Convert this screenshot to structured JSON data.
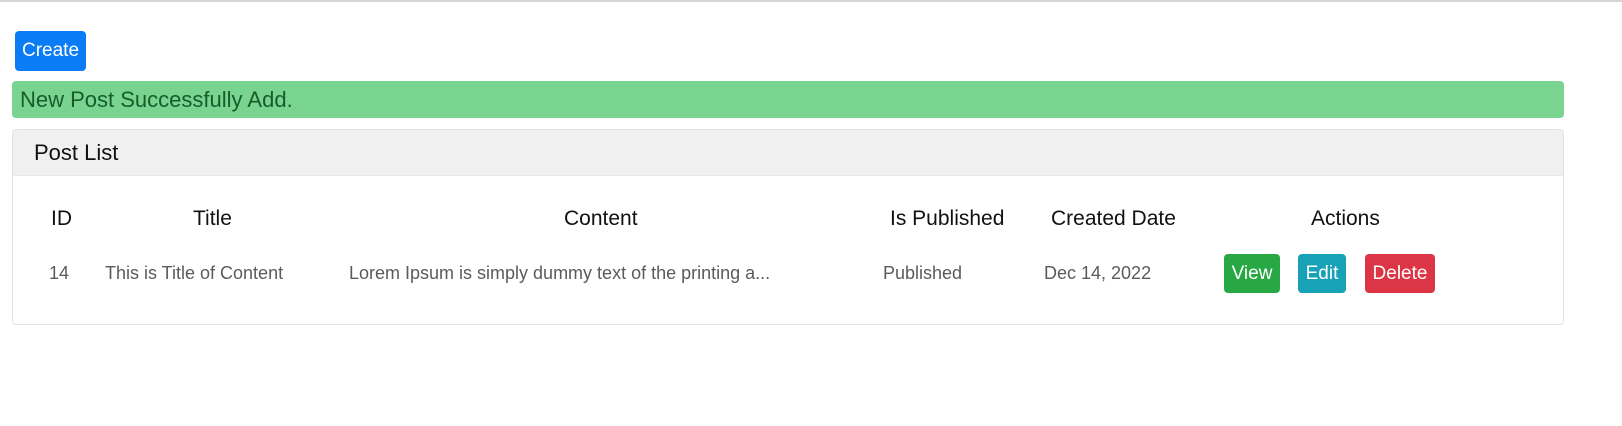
{
  "toolbar": {
    "create_label": "Create"
  },
  "alert": {
    "message": "New Post Successfully Add."
  },
  "card": {
    "title": "Post List"
  },
  "table": {
    "columns": [
      "ID",
      "Title",
      "Content",
      "Is Published",
      "Created Date",
      "Actions"
    ],
    "rows": [
      {
        "id": "14",
        "title": "This is Title of Content",
        "content": "Lorem Ipsum is simply dummy text of the printing a...",
        "is_published": "Published",
        "created_date": "Dec 14, 2022",
        "actions": {
          "view": "View",
          "edit": "Edit",
          "delete": "Delete"
        }
      }
    ]
  },
  "colors": {
    "primary": "#0a7cf5",
    "success_alert_bg": "#79d48f",
    "success_alert_text": "#175d2b",
    "view": "#28a745",
    "edit": "#17a2b8",
    "delete": "#dc3545"
  }
}
